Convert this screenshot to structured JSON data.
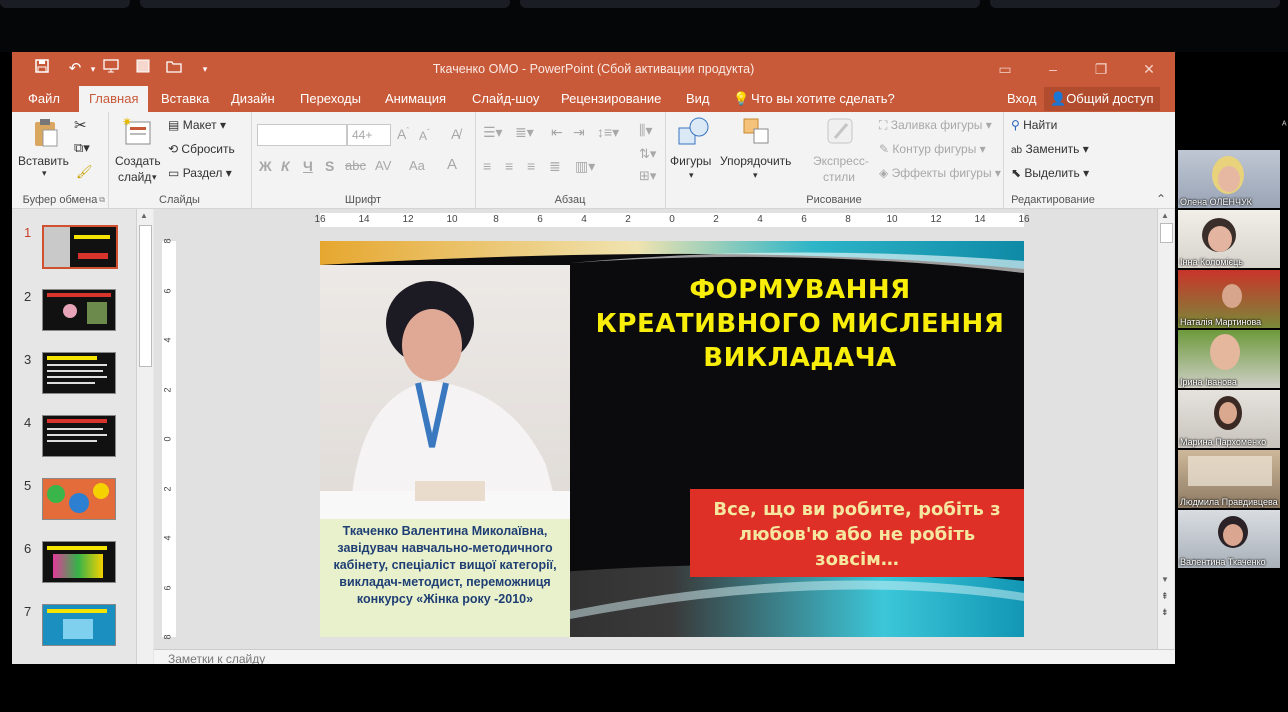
{
  "window": {
    "title": "Ткаченко ОМО - PowerPoint (Сбой активации продукта)",
    "accent": "#c85a3a"
  },
  "tabs": [
    "Файл",
    "Главная",
    "Вставка",
    "Дизайн",
    "Переходы",
    "Анимация",
    "Слайд-шоу",
    "Рецензирование",
    "Вид"
  ],
  "tell_me": "Что вы хотите сделать?",
  "signin": "Вход",
  "share": "Общий доступ",
  "ribbon": {
    "clipboard": {
      "paste": "Вставить",
      "label": "Буфер обмена"
    },
    "slides": {
      "new_slide": "Создать",
      "new_slide2": "слайд",
      "layout": "Макет",
      "reset": "Сбросить",
      "section": "Раздел",
      "label": "Слайды"
    },
    "font": {
      "size": "44+",
      "bold": "Ж",
      "italic": "К",
      "underline": "Ч",
      "strike": "S",
      "spacing": "AV",
      "case": "Aa",
      "color": "A",
      "label": "Шрифт"
    },
    "paragraph": {
      "label": "Абзац"
    },
    "drawing": {
      "shapes": "Фигуры",
      "arrange": "Упорядочить",
      "styles": "Экспресс-",
      "styles2": "стили",
      "fill": "Заливка фигуры",
      "outline": "Контур фигуры",
      "effects": "Эффекты фигуры",
      "label": "Рисование"
    },
    "editing": {
      "find": "Найти",
      "replace": "Заменить",
      "select": "Выделить",
      "label": "Редактирование"
    }
  },
  "thumbnails": [
    "1",
    "2",
    "3",
    "4",
    "5",
    "6",
    "7"
  ],
  "ruler": {
    "h": [
      "16",
      "14",
      "12",
      "10",
      "8",
      "6",
      "4",
      "2",
      "0",
      "2",
      "4",
      "6",
      "8",
      "10",
      "12",
      "14",
      "16"
    ],
    "v": [
      "8",
      "6",
      "4",
      "2",
      "0",
      "2",
      "4",
      "6",
      "8"
    ]
  },
  "slide": {
    "title": "ФОРМУВАННЯ КРЕАТИВНОГО МИСЛЕННЯ ВИКЛАДАЧА",
    "caption": "Ткаченко     Валентина Миколаївна,  завідувач навчально-методичного кабінету, спеціаліст вищої категорії, викладач-методист, переможниця конкурсу «Жінка року -2010»",
    "quote": "Все, що ви робите, робіть з любов'ю або не робіть зовсім…"
  },
  "notes_placeholder": "Заметки к слайду",
  "participants": [
    "Олена ОЛЕНЧУК",
    "Інна Коломієць",
    "Наталія Мартинова",
    "Ірина Іванова",
    "Марина Пархоменко",
    "Людмила Правдивцева",
    "Валентина Ткаченко"
  ]
}
